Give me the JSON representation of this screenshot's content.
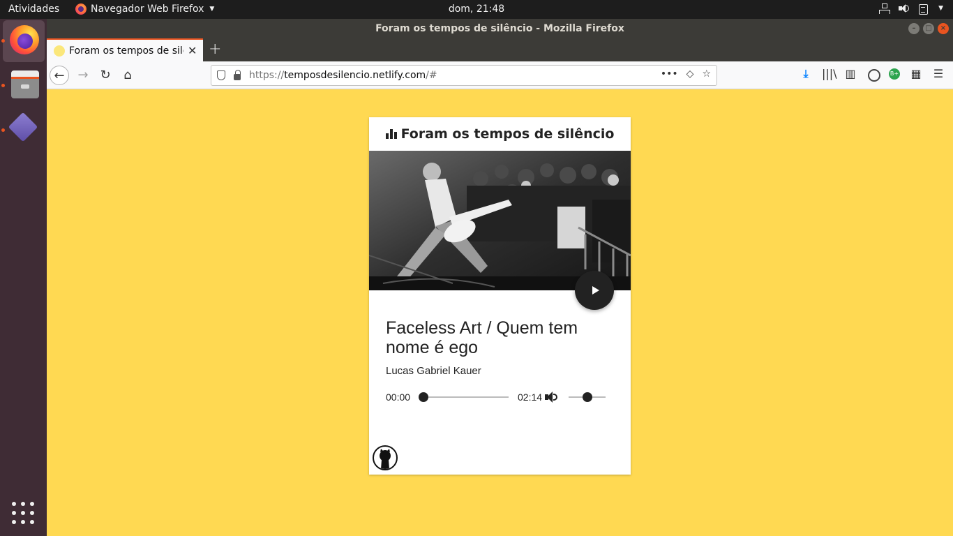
{
  "topbar": {
    "activities": "Atividades",
    "app_menu": "Navegador Web Firefox",
    "clock": "dom, 21:48"
  },
  "window": {
    "title": "Foram os tempos de silêncio - Mozilla Firefox"
  },
  "tab": {
    "title": "Foram os tempos de silêncio"
  },
  "urlbar": {
    "url_prefix": "https://",
    "url_host": "temposdesilencio.netlify.com",
    "url_suffix": "/#"
  },
  "colors": {
    "page_background": "#ffd952",
    "accent": "#e95420",
    "download_icon": "#0a84ff"
  },
  "page": {
    "header_title": "Foram os tempos de silêncio",
    "header_icon": "bar-chart-icon",
    "cover_image": "black-and-white punk concert photo: guitarist leaning back playing to a crowd behind a barrier"
  },
  "player": {
    "song_title": "Faceless Art / Quem tem nome é ego",
    "artist": "Lucas Gabriel Kauer",
    "current_time": "00:00",
    "duration": "02:14",
    "progress_fraction": 0,
    "volume_fraction": 0.5
  },
  "footer": {
    "link_icon": "github-icon"
  }
}
